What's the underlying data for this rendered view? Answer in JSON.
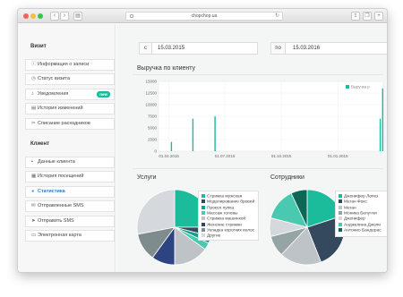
{
  "browser": {
    "url": "chopchop.ua",
    "back_label": "‹",
    "forward_label": "›",
    "reload_label": "↻"
  },
  "sidebar": {
    "section_visit": "Визит",
    "visit_items": [
      {
        "label": "Информация о записи",
        "icon": "info-icon"
      },
      {
        "label": "Статус визита",
        "icon": "clock-icon"
      },
      {
        "label": "Уведомления",
        "icon": "bell-icon",
        "badge": "new"
      },
      {
        "label": "История изменений",
        "icon": "history-icon"
      },
      {
        "label": "Списание расходников",
        "icon": "tools-icon"
      }
    ],
    "section_client": "Клиент",
    "client_items": [
      {
        "label": "Данные клиента",
        "icon": "user-icon"
      },
      {
        "label": "История посещений",
        "icon": "calendar-icon"
      },
      {
        "label": "Статистика",
        "icon": "chart-icon"
      },
      {
        "label": "Отправленные SMS",
        "icon": "message-icon"
      },
      {
        "label": "Отправить SMS",
        "icon": "send-icon"
      },
      {
        "label": "Электронная карта",
        "icon": "card-icon"
      }
    ]
  },
  "filters": {
    "from_label": "с",
    "from_value": "15.03.2015",
    "to_label": "по",
    "to_value": "15.03.2016"
  },
  "revenue": {
    "title": "Выручка по клиенту",
    "legend": "Выручка р",
    "color": "#1abc9c"
  },
  "services": {
    "title": "Услуги",
    "legend": [
      {
        "label": "Стрижка мужская",
        "color": "#1abc9c"
      },
      {
        "label": "Моделирование бровей",
        "color": "#34495e"
      },
      {
        "label": "Прокол пупка",
        "color": "#16a085"
      },
      {
        "label": "Массаж головы",
        "color": "#48c9b0"
      },
      {
        "label": "Стрижка машинкой",
        "color": "#bdc3c7"
      },
      {
        "label": "Женские стрижки",
        "color": "#2e4482"
      },
      {
        "label": "Укладка коротких волос",
        "color": "#7f8c8d"
      },
      {
        "label": "Другие",
        "color": "#d5d8dc"
      }
    ]
  },
  "employees": {
    "title": "Сотрудники",
    "legend": [
      {
        "label": "Дженифер Лопез",
        "color": "#1abc9c"
      },
      {
        "label": "Меган Фокс",
        "color": "#34495e"
      },
      {
        "label": "Меган",
        "color": "#bdc3c7"
      },
      {
        "label": "Моника Белуччи",
        "color": "#95a5a6"
      },
      {
        "label": "Дженифер",
        "color": "#d5d8dc"
      },
      {
        "label": "Анджелина Джоли",
        "color": "#48c9b0"
      },
      {
        "label": "Антонио Бандерас",
        "color": "#0e6655"
      }
    ]
  },
  "chart_data": [
    {
      "type": "bar",
      "title": "Выручка по клиенту",
      "ylim": [
        0,
        15000
      ],
      "yticks": [
        "15000",
        "12500",
        "10000",
        "7500",
        "5000",
        "2500",
        "0"
      ],
      "xticks": [
        "01.04.2015",
        "01.07.2015",
        "01.10.2015",
        "01.01.2016"
      ],
      "legend": "top-right",
      "series": [
        {
          "name": "Выручка р",
          "points": [
            {
              "x": "2015-04-05",
              "y": 2000
            },
            {
              "x": "2015-05-10",
              "y": 7000
            },
            {
              "x": "2015-06-15",
              "y": 7500
            },
            {
              "x": "2016-03-10",
              "y": 7000
            },
            {
              "x": "2016-03-14",
              "y": 13500
            }
          ]
        }
      ]
    },
    {
      "type": "pie",
      "title": "Услуги",
      "categories": [
        "Стрижка мужская",
        "Моделирование бровей",
        "Прокол пупка",
        "Массаж головы",
        "Стрижка машинкой",
        "Женские стрижки",
        "Укладка коротких волос",
        "Другие"
      ],
      "values": [
        25,
        4,
        3,
        3,
        15,
        10,
        12,
        28
      ]
    },
    {
      "type": "pie",
      "title": "Сотрудники",
      "categories": [
        "Дженифер Лопез",
        "Меган Фокс",
        "Меган",
        "Моника Белуччи",
        "Дженифер",
        "Анджелина Джоли",
        "Антонио Бандерас"
      ],
      "values": [
        20,
        24,
        18,
        9,
        8,
        14,
        7
      ]
    }
  ]
}
